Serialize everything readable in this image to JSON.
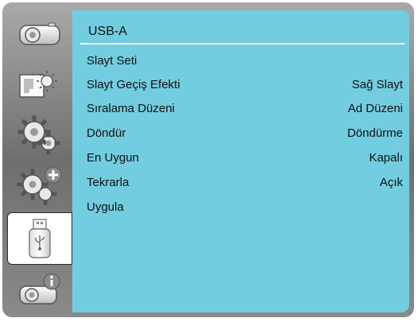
{
  "panel": {
    "title": "USB-A"
  },
  "sidebar": {
    "items": [
      {
        "icon": "projector-icon"
      },
      {
        "icon": "picture-brightness-icon"
      },
      {
        "icon": "gears-icon"
      },
      {
        "icon": "gears-plus-icon"
      },
      {
        "icon": "usb-drive-icon",
        "active": true
      },
      {
        "icon": "info-projector-icon"
      }
    ]
  },
  "menu": [
    {
      "label": "Slayt Seti",
      "value": ""
    },
    {
      "label": "Slayt Geçiş Efekti",
      "value": "Sağ Slayt"
    },
    {
      "label": "Sıralama Düzeni",
      "value": "Ad Düzeni"
    },
    {
      "label": "Döndür",
      "value": "Döndürme"
    },
    {
      "label": "En Uygun",
      "value": "Kapalı"
    },
    {
      "label": "Tekrarla",
      "value": "Açık"
    },
    {
      "label": "Uygula",
      "value": ""
    }
  ],
  "colors": {
    "panel": "#73cde0",
    "frame": "#808080",
    "active_tab": "#ffffff"
  }
}
